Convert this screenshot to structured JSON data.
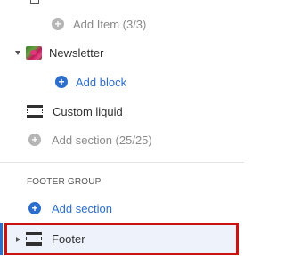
{
  "sidebar": {
    "add_item": {
      "label": "Add Item (3/3)"
    },
    "newsletter": {
      "label": "Newsletter"
    },
    "add_block": {
      "label": "Add block"
    },
    "custom_liquid": {
      "label": "Custom liquid"
    },
    "add_section_template": {
      "label": "Add section (25/25)"
    },
    "footer_group": {
      "heading": "FOOTER GROUP",
      "add_section": {
        "label": "Add section"
      },
      "footer": {
        "label": "Footer"
      }
    }
  },
  "colors": {
    "accent": "#2c6ecb",
    "highlight_border": "#cc1111",
    "muted": "#8a8a8a"
  },
  "icons": {
    "partial": "block-icon",
    "add_item": "plus-circle-icon",
    "newsletter_thumb": "image-thumbnail-icon",
    "custom_liquid": "section-block-icon",
    "footer": "section-block-icon"
  }
}
